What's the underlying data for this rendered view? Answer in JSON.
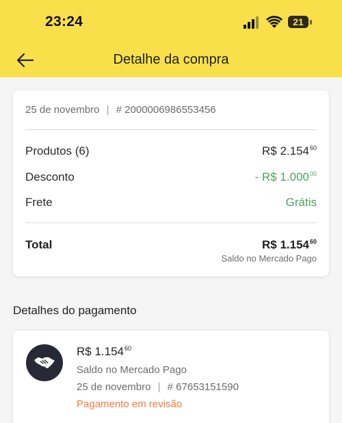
{
  "status_bar": {
    "time": "23:24",
    "battery": "21"
  },
  "header": {
    "title": "Detalhe da compra"
  },
  "summary": {
    "date": "25 de novembro",
    "separator": "|",
    "order_number": "# 2000006986553456",
    "products_label": "Produtos (6)",
    "products_value": "R$ 2.154",
    "products_cents": "60",
    "discount_label": "Desconto",
    "discount_value": "- R$ 1.000",
    "discount_cents": "00",
    "shipping_label": "Frete",
    "shipping_value": "Grátis",
    "total_label": "Total",
    "total_value": "R$ 1.154",
    "total_cents": "60",
    "total_method": "Saldo no Mercado Pago"
  },
  "payment": {
    "section_title": "Detalhes do pagamento",
    "amount": "R$ 1.154",
    "amount_cents": "60",
    "method": "Saldo no Mercado Pago",
    "date": "25 de novembro",
    "separator": "|",
    "operation_number": "# 67653151590",
    "status": "Pagamento em revisão"
  },
  "colors": {
    "header_bg": "#f9e04b",
    "discount_green": "#4aa35b",
    "status_orange": "#f07c3c",
    "logo_bg": "#272a34"
  },
  "icons": {
    "back": "arrow-left-icon",
    "signal": "cellular-signal-icon",
    "wifi": "wifi-icon",
    "battery": "battery-icon",
    "payment_logo": "handshake-icon"
  }
}
